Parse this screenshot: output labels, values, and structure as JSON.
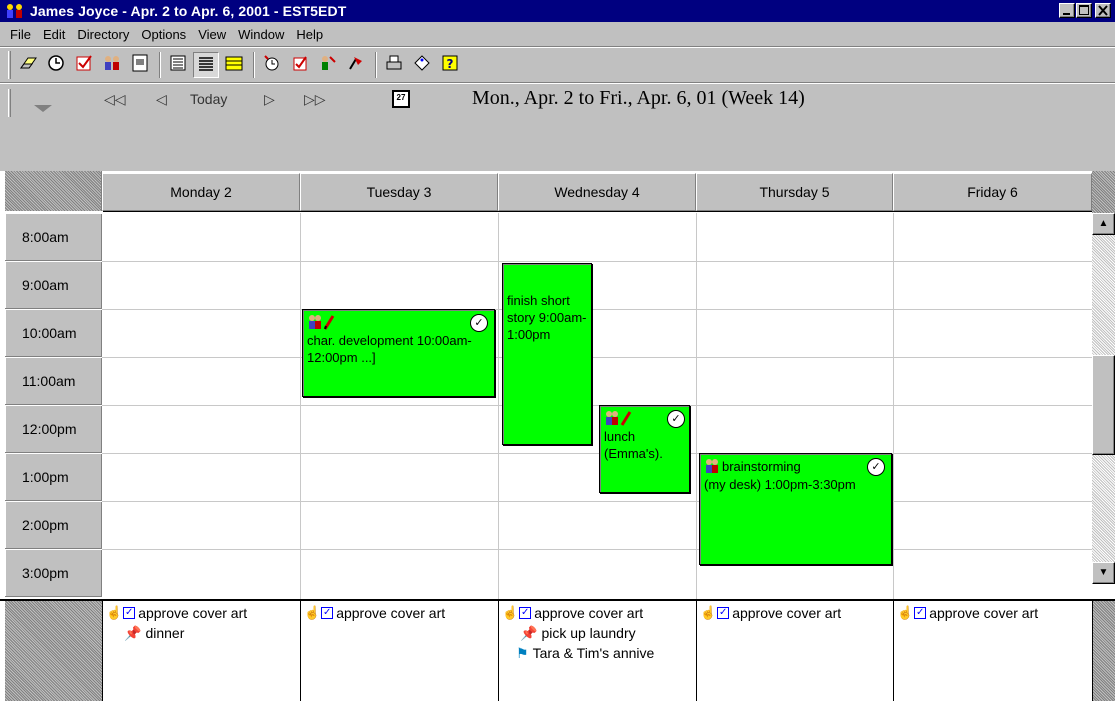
{
  "window": {
    "title": "James Joyce  - Apr. 2  to Apr. 6, 2001 - EST5EDT"
  },
  "menu": [
    "File",
    "Edit",
    "Directory",
    "Options",
    "View",
    "Window",
    "Help"
  ],
  "toolbar": {
    "icons": [
      "eraser-icon",
      "clock-icon",
      "check-box-icon",
      "people-icon",
      "address-book-icon",
      "day-view-icon",
      "week-view-icon",
      "month-view-icon",
      "new-reminder-icon",
      "new-task-icon",
      "new-event-icon",
      "new-note-icon",
      "print-icon",
      "tag-icon",
      "help-icon"
    ]
  },
  "nav": {
    "first": "◁◁",
    "prev": "◁",
    "today": "Today",
    "next": "▷",
    "last": "▷▷",
    "calendar_icon_day": "27",
    "range": "Mon., Apr. 2 to Fri., Apr. 6, 01  (Week 14)"
  },
  "days": [
    "Monday 2",
    "Tuesday 3",
    "Wednesday 4",
    "Thursday 5",
    "Friday 6"
  ],
  "times": [
    "8:00am",
    "9:00am",
    "10:00am",
    "11:00am",
    "12:00pm",
    "1:00pm",
    "2:00pm",
    "3:00pm"
  ],
  "events": [
    {
      "text": "char. development 10:00am-12:00pm ...]"
    },
    {
      "text": "finish short story 9:00am-1:00pm"
    },
    {
      "text": "lunch (Emma's)."
    },
    {
      "title": "brainstorming",
      "text": "(my desk) 1:00pm-3:30pm"
    }
  ],
  "tasks": {
    "mon": [
      "approve cover art",
      "dinner"
    ],
    "tue": [
      "approve cover art"
    ],
    "wed": [
      "approve cover art",
      "pick up laundry",
      "Tara & Tim's annive"
    ],
    "thu": [
      "approve cover art"
    ],
    "fri": [
      "approve cover art"
    ]
  },
  "colors": {
    "event": "#00ff00",
    "titlebar": "#000080",
    "chrome": "#c0c0c0"
  }
}
